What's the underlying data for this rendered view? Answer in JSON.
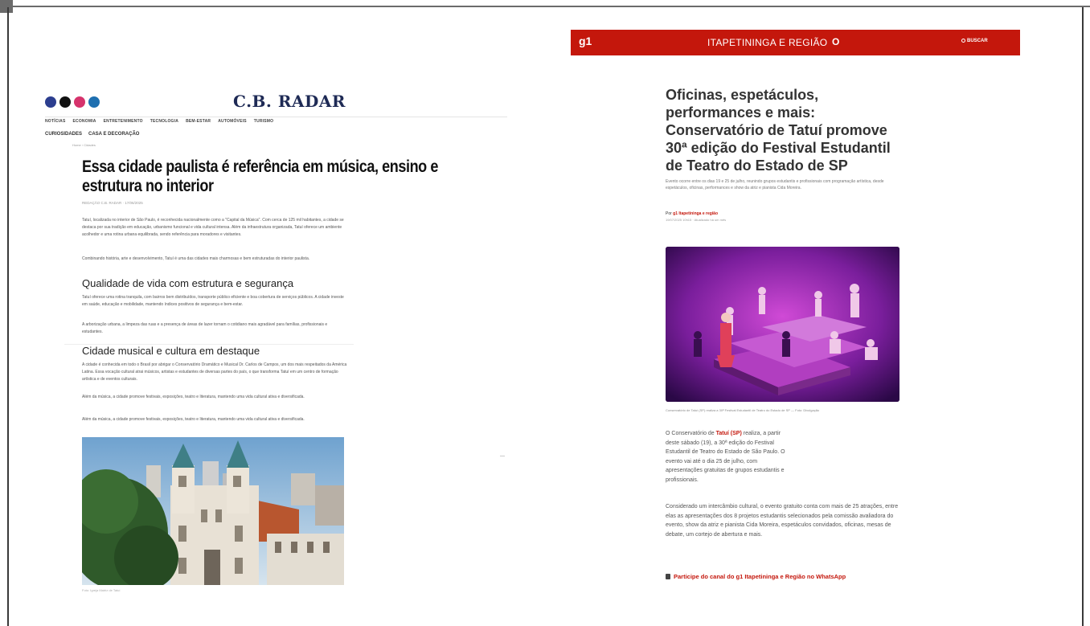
{
  "left_article": {
    "brand": "C.B. RADAR",
    "social_icons": [
      "facebook-icon",
      "x-icon",
      "instagram-icon",
      "linkedin-icon"
    ],
    "nav_items": [
      "NOTÍCIAS",
      "ECONOMIA",
      "ENTRETENIMENTO",
      "TECNOLOGIA",
      "BEM-ESTAR",
      "AUTOMÓVEIS",
      "TURISMO"
    ],
    "nav_items_2": [
      "CURIOSIDADES",
      "CASA E DECORAÇÃO"
    ],
    "breadcrumb": "Home › Cidades",
    "headline": "Essa cidade paulista é referência em música, ensino e estrutura no interior",
    "byline": "REDAÇÃO C.B. RADAR  ·  17/06/2025",
    "para1": "Tatuí, localizada no interior de São Paulo, é reconhecida nacionalmente como a \"Capital da Música\". Com cerca de 125 mil habitantes, a cidade se destaca por sua tradição em educação, urbanismo funcional e vida cultural intensa. Além da infraestrutura organizada, Tatuí oferece um ambiente acolhedor e uma rotina urbana equilibrada, sendo referência para moradores e visitantes.",
    "para2": "Combinando história, arte e desenvolvimento, Tatuí é uma das cidades mais charmosas e bem estruturadas do interior paulista.",
    "h2_1": "Qualidade de vida com estrutura e segurança",
    "para3": "Tatuí oferece uma rotina tranquila, com bairros bem distribuídos, transporte público eficiente e boa cobertura de serviços públicos. A cidade investe em saúde, educação e mobilidade, mantendo índices positivos de segurança e bem-estar.",
    "para4": "A arborização urbana, a limpeza das ruas e a presença de áreas de lazer tornam o cotidiano mais agradável para famílias, profissionais e estudantes.",
    "h2_2": "Cidade musical e cultura em destaque",
    "para5": "A cidade é conhecida em todo o Brasil por abrigar o Conservatório Dramático e Musical Dr. Carlos de Campos, um dos mais respeitados da América Latina. Essa vocação cultural atrai músicos, artistas e estudantes de diversas partes do país, o que transforma Tatuí em um centro de formação artística e de eventos culturais.",
    "para6": "Além da música, a cidade promove festivais, exposições, teatro e literatura, mantendo uma vida cultural ativa e diversificada.",
    "para7": "Além da música, a cidade promove festivais, exposições, teatro e literatura, mantendo uma vida cultural ativa e diversificada.",
    "photo_caption": "Foto: Igreja Matriz de Tatuí"
  },
  "right_article": {
    "logo": "g1",
    "region": "ITAPETININGA E REGIÃO",
    "globo_mark": "O",
    "search_label": "BUSCAR",
    "title": "Oficinas, espetáculos, performances e mais: Conservatório de Tatuí promove 30ª edição do Festival Estudantil de Teatro do Estado de SP",
    "subtitle": "Evento ocorre entre os dias 19 e 25 de julho, reunindo grupos estudantis e profissionais com programação artística, desde espetáculos, oficinas, performances e show da atriz e pianista Cida Moreira.",
    "author_prefix": "Por ",
    "author": "g1 Itapetininga e região",
    "date": "19/07/2025 10h15 · Atualizado há um mês",
    "image_caption": "Conservatório de Tatuí (SP) realiza a 30ª Festival Estudantil de Teatro do Estado de SP — Foto: Divulgação",
    "p1_before": "O Conservatório de ",
    "p1_link": "Tatuí (SP)",
    "p1_after": " realiza, a partir deste sábado (19), a 30ª edição do Festival Estudantil de Teatro do Estado de São Paulo. O evento vai até o dia 25 de julho, com apresentações gratuitas de grupos estudantis e profissionais.",
    "p2": "Considerado um intercâmbio cultural, o evento gratuito conta com mais de 25 atrações, entre elas as apresentações dos 8 projetos estudantis selecionados pela comissão avaliadora do evento, show da atriz e pianista Cida Moreira, espetáculos convidados, oficinas, mesas de debate, um cortejo de abertura e mais.",
    "whatsapp_link": "Participe do canal do g1 Itapetininga e Região no WhatsApp"
  },
  "colors": {
    "g1_red": "#c4170c",
    "cbradar_navy": "#1e2a55"
  }
}
